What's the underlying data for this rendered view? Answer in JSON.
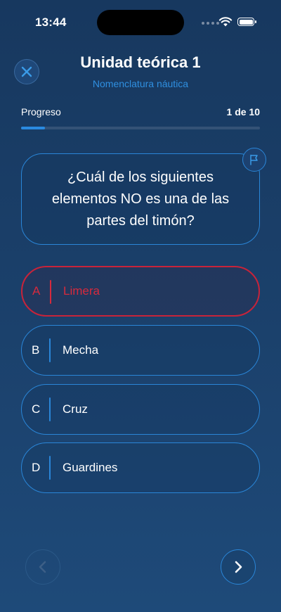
{
  "status_bar": {
    "time": "13:44"
  },
  "header": {
    "title": "Unidad teórica 1",
    "subtitle": "Nomenclatura náutica",
    "close_icon": "close-icon"
  },
  "progress": {
    "label": "Progreso",
    "count_text": "1 de 10",
    "fraction": 0.1
  },
  "question": {
    "text": "¿Cuál de los siguientes elementos NO es una de las partes del timón?",
    "flag_icon": "flag-icon"
  },
  "options": [
    {
      "letter": "A",
      "label": "Limera",
      "selected": true
    },
    {
      "letter": "B",
      "label": "Mecha",
      "selected": false
    },
    {
      "letter": "C",
      "label": "Cruz",
      "selected": false
    },
    {
      "letter": "D",
      "label": "Guardines",
      "selected": false
    }
  ],
  "navigation": {
    "prev_icon": "chevron-left-icon",
    "next_icon": "chevron-right-icon"
  },
  "colors": {
    "accent": "#2a86d8",
    "selected_error": "#d62a3d",
    "background_top": "#17385f",
    "background_bottom": "#1e4a79"
  }
}
